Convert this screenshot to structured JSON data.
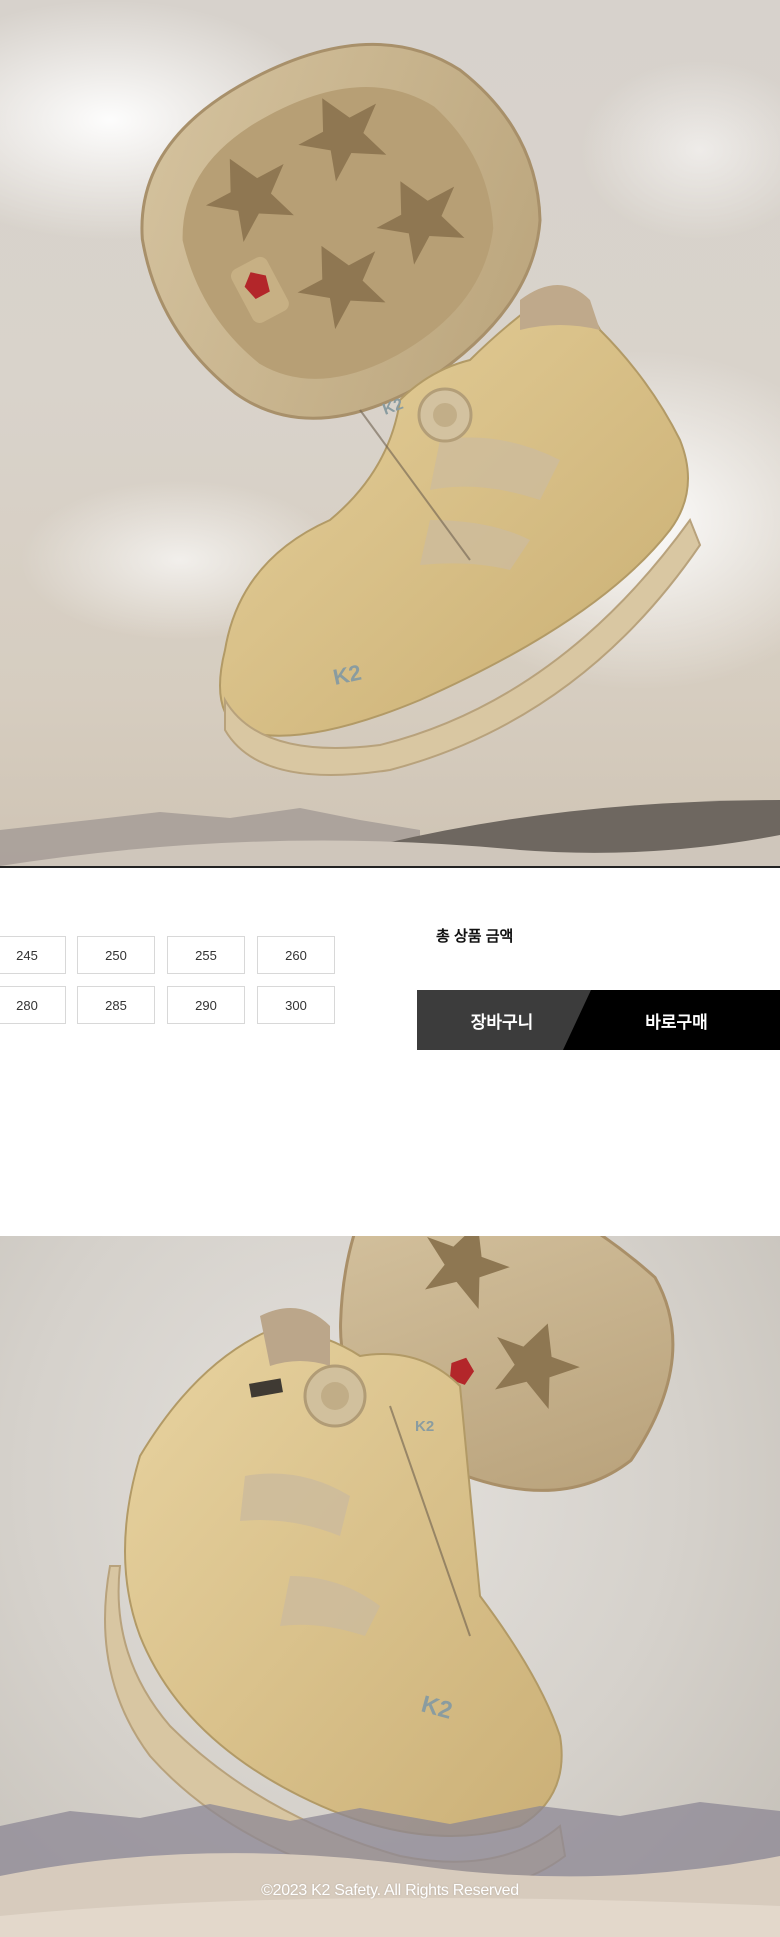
{
  "hero_top": {
    "image": "k2-desert-boots-pair-floating-in-clouds"
  },
  "options": {
    "sizes_row1": [
      "245",
      "250",
      "255",
      "260"
    ],
    "sizes_row2": [
      "280",
      "285",
      "290",
      "300"
    ]
  },
  "summary": {
    "total_label": "총 상품 금액"
  },
  "actions": {
    "cart_label": "장바구니",
    "buy_label": "바로구매"
  },
  "hero_bottom": {
    "image": "k2-desert-mid-boots-over-dunes"
  },
  "footer": {
    "copyright": "©2023 K2 Safety. All Rights Reserved"
  },
  "colors": {
    "cart_bg": "#3c3c3c",
    "buy_bg": "#000000",
    "boot_tan": "#d8c08a"
  }
}
